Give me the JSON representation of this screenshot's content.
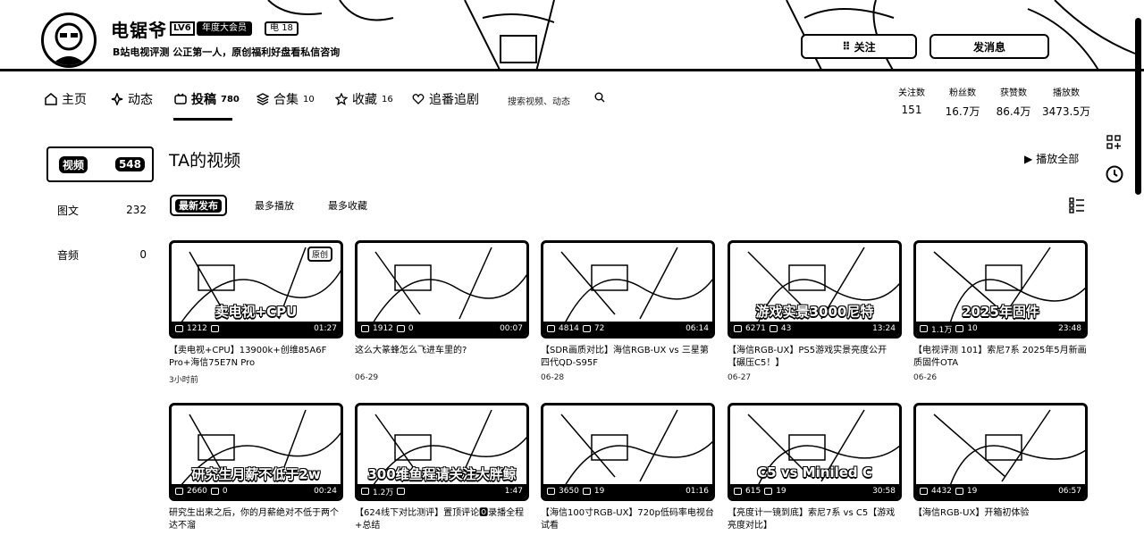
{
  "profile": {
    "username": "电锯爷",
    "level": "LV6",
    "vip_tag": "年度大会员",
    "medal_name": "电",
    "medal_level": "18",
    "sign": "B站电视评测 公正第一人，原创福利好盘看私信咨询"
  },
  "actions": {
    "follow": "关注",
    "message": "发消息"
  },
  "nav": {
    "items": [
      {
        "label": "主页",
        "count": ""
      },
      {
        "label": "动态",
        "count": ""
      },
      {
        "label": "投稿",
        "count": "780"
      },
      {
        "label": "合集",
        "count": "10"
      },
      {
        "label": "收藏",
        "count": "16"
      },
      {
        "label": "追番追剧",
        "count": ""
      }
    ],
    "search_placeholder": "搜索视频、动态"
  },
  "stats": [
    {
      "label": "关注数",
      "value": "151"
    },
    {
      "label": "粉丝数",
      "value": "16.7万"
    },
    {
      "label": "获赞数",
      "value": "86.4万"
    },
    {
      "label": "播放数",
      "value": "3473.5万"
    }
  ],
  "sidebar": [
    {
      "label": "视频",
      "count": "548"
    },
    {
      "label": "图文",
      "count": "232"
    },
    {
      "label": "音频",
      "count": "0"
    }
  ],
  "section_title": "TA的视频",
  "play_all": "播放全部",
  "sort_tabs": [
    "最新发布",
    "最多播放",
    "最多收藏"
  ],
  "videos": [
    {
      "caption": "卖电视+CPU",
      "corner": "原创",
      "views": "1212",
      "danmaku": "",
      "duration": "01:27",
      "title": "【卖电视+CPU】13900k+创维85A6F Pro+海信75E7N Pro",
      "date": "3小时前"
    },
    {
      "caption": "",
      "corner": "",
      "views": "1912",
      "danmaku": "0",
      "duration": "00:07",
      "title": "这么大篆蜂怎么飞进车里的?",
      "date": "06-29"
    },
    {
      "caption": "",
      "corner": "",
      "views": "4814",
      "danmaku": "72",
      "duration": "06:14",
      "title": "【SDR画质对比】海信RGB-UX vs 三星第四代QD-S95F",
      "date": "06-28"
    },
    {
      "caption": "游戏实景3000尼特",
      "corner": "",
      "views": "6271",
      "danmaku": "43",
      "duration": "13:24",
      "title": "【海信RGB-UX】PS5游戏实景亮度公开【碾压C5！】",
      "date": "06-27"
    },
    {
      "caption": "2025年固件",
      "corner": "",
      "views": "1.1万",
      "danmaku": "10",
      "duration": "23:48",
      "title": "【电视评测 101】索尼7系 2025年5月新画质固件OTA",
      "date": "06-26"
    },
    {
      "caption": "研究生月薪不低于2w",
      "corner": "",
      "views": "2660",
      "danmaku": "0",
      "duration": "00:24",
      "title": "研究生出来之后，你的月薪绝对不低于两个达不溜",
      "date": ""
    },
    {
      "caption": "300维鱼程请关注大胖鲸",
      "corner": "",
      "views": "1.2万",
      "danmaku": "",
      "duration": "1:47",
      "title": "【624线下对比测评】置顶评论🅾录播全程+总结",
      "date": ""
    },
    {
      "caption": "",
      "corner": "",
      "views": "3650",
      "danmaku": "19",
      "duration": "01:16",
      "title": "【海信100寸RGB-UX】720p低码率电视台试看",
      "date": ""
    },
    {
      "caption": "C5 vs Miniled C",
      "corner": "",
      "views": "615",
      "danmaku": "19",
      "duration": "30:58",
      "title": "【亮度计一镜到底】索尼7系 vs C5【游戏亮度对比】",
      "date": ""
    },
    {
      "caption": "",
      "corner": "",
      "views": "4432",
      "danmaku": "19",
      "duration": "06:57",
      "title": "【海信RGB-UX】开箱初体验",
      "date": ""
    }
  ]
}
